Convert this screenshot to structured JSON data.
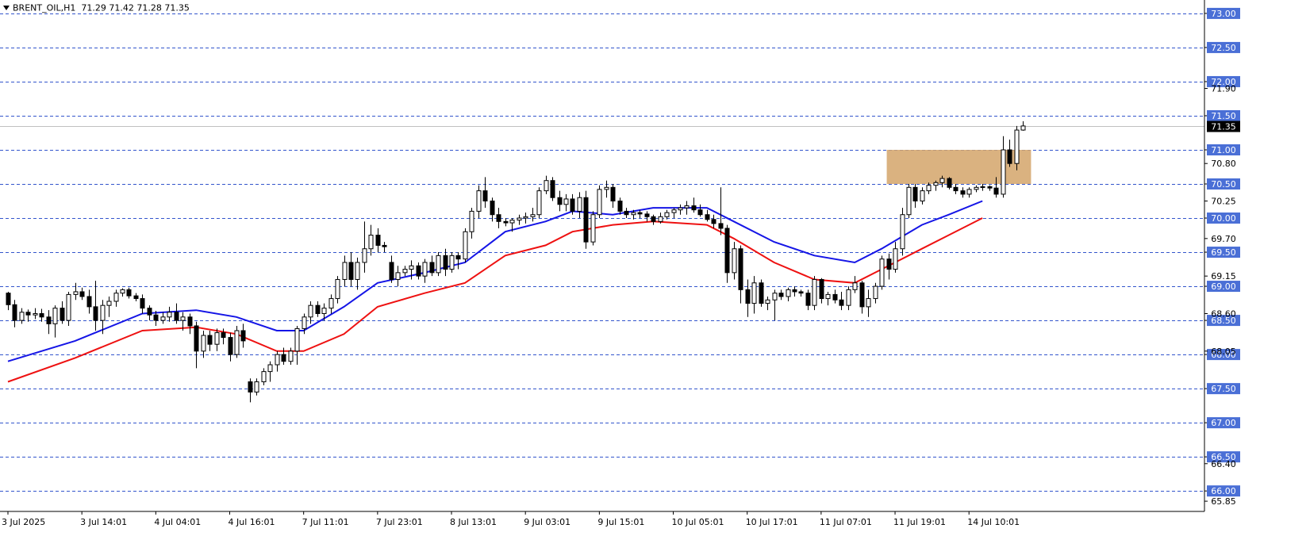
{
  "header": {
    "symbol": "BRENT_OIL,H1",
    "ohlc": "71.29 71.42 71.28 71.35"
  },
  "chart_data": {
    "type": "candlestick",
    "ylim": [
      65.7,
      73.15
    ],
    "current_price": 71.35,
    "current_price_label": "71.35",
    "colors": {
      "level_line": "#3355cc",
      "ma_fast": "#1515e6",
      "ma_slow": "#ee1111",
      "zone": "#d4a56a",
      "bull_body": "#ffffff",
      "bear_body": "#000000",
      "label_bg": "#4a6fd6",
      "current_bg": "#000000"
    },
    "level_lines": [
      "73.00",
      "72.50",
      "72.00",
      "71.50",
      "71.00",
      "70.50",
      "70.00",
      "69.50",
      "69.00",
      "68.50",
      "68.00",
      "67.50",
      "67.00",
      "66.50",
      "66.00"
    ],
    "plain_ticks": [
      "71.90",
      "70.80",
      "70.25",
      "69.70",
      "69.15",
      "68.60",
      "68.05",
      "66.40",
      "65.85"
    ],
    "zone": {
      "price_low": 70.5,
      "price_high": 71.0,
      "from_index": 131,
      "to_index": 152
    },
    "x_labels": [
      {
        "index": 0,
        "label": "3 Jul 2025"
      },
      {
        "index": 11,
        "label": "3 Jul 14:01"
      },
      {
        "index": 22,
        "label": "4 Jul 04:01"
      },
      {
        "index": 33,
        "label": "4 Jul 16:01"
      },
      {
        "index": 44,
        "label": "7 Jul 11:01"
      },
      {
        "index": 55,
        "label": "7 Jul 23:01"
      },
      {
        "index": 66,
        "label": "8 Jul 13:01"
      },
      {
        "index": 77,
        "label": "9 Jul 03:01"
      },
      {
        "index": 88,
        "label": "9 Jul 15:01"
      },
      {
        "index": 99,
        "label": "10 Jul 05:01"
      },
      {
        "index": 110,
        "label": "10 Jul 17:01"
      },
      {
        "index": 121,
        "label": "11 Jul 07:01"
      },
      {
        "index": 132,
        "label": "11 Jul 19:01"
      },
      {
        "index": 143,
        "label": "14 Jul 10:01"
      }
    ],
    "ma_fast": [
      [
        0,
        67.9
      ],
      [
        10,
        68.2
      ],
      [
        20,
        68.6
      ],
      [
        28,
        68.65
      ],
      [
        34,
        68.55
      ],
      [
        40,
        68.35
      ],
      [
        44,
        68.35
      ],
      [
        50,
        68.7
      ],
      [
        55,
        69.05
      ],
      [
        62,
        69.2
      ],
      [
        68,
        69.35
      ],
      [
        74,
        69.8
      ],
      [
        80,
        69.95
      ],
      [
        84,
        70.1
      ],
      [
        90,
        70.05
      ],
      [
        96,
        70.15
      ],
      [
        104,
        70.15
      ],
      [
        108,
        69.95
      ],
      [
        114,
        69.65
      ],
      [
        120,
        69.45
      ],
      [
        126,
        69.35
      ],
      [
        130,
        69.55
      ],
      [
        136,
        69.9
      ],
      [
        140,
        70.05
      ],
      [
        145,
        70.25
      ]
    ],
    "ma_slow": [
      [
        0,
        67.6
      ],
      [
        10,
        67.95
      ],
      [
        20,
        68.35
      ],
      [
        28,
        68.4
      ],
      [
        34,
        68.3
      ],
      [
        40,
        68.05
      ],
      [
        44,
        68.05
      ],
      [
        50,
        68.3
      ],
      [
        55,
        68.7
      ],
      [
        62,
        68.9
      ],
      [
        68,
        69.05
      ],
      [
        74,
        69.45
      ],
      [
        80,
        69.6
      ],
      [
        84,
        69.8
      ],
      [
        90,
        69.9
      ],
      [
        96,
        69.95
      ],
      [
        104,
        69.9
      ],
      [
        108,
        69.7
      ],
      [
        114,
        69.35
      ],
      [
        120,
        69.1
      ],
      [
        126,
        69.05
      ],
      [
        130,
        69.25
      ],
      [
        136,
        69.55
      ],
      [
        140,
        69.75
      ],
      [
        145,
        70.0
      ]
    ],
    "candles": [
      [
        68.9,
        68.92,
        68.65,
        68.73
      ],
      [
        68.73,
        68.8,
        68.4,
        68.5
      ],
      [
        68.5,
        68.68,
        68.45,
        68.62
      ],
      [
        68.62,
        68.66,
        68.48,
        68.58
      ],
      [
        68.58,
        68.68,
        68.52,
        68.6
      ],
      [
        68.6,
        68.67,
        68.48,
        68.55
      ],
      [
        68.55,
        68.65,
        68.3,
        68.45
      ],
      [
        68.45,
        68.72,
        68.25,
        68.68
      ],
      [
        68.68,
        68.78,
        68.45,
        68.5
      ],
      [
        68.5,
        68.92,
        68.42,
        68.88
      ],
      [
        68.88,
        69.05,
        68.8,
        68.92
      ],
      [
        68.92,
        68.98,
        68.8,
        68.85
      ],
      [
        68.85,
        68.95,
        68.6,
        68.7
      ],
      [
        68.7,
        69.08,
        68.35,
        68.5
      ],
      [
        68.5,
        68.8,
        68.3,
        68.72
      ],
      [
        68.72,
        68.85,
        68.55,
        68.78
      ],
      [
        68.78,
        68.95,
        68.7,
        68.9
      ],
      [
        68.9,
        68.97,
        68.85,
        68.95
      ],
      [
        68.95,
        68.98,
        68.82,
        68.86
      ],
      [
        68.86,
        68.9,
        68.78,
        68.82
      ],
      [
        68.82,
        68.88,
        68.6,
        68.68
      ],
      [
        68.68,
        68.72,
        68.5,
        68.58
      ],
      [
        68.58,
        68.64,
        68.42,
        68.5
      ],
      [
        68.5,
        68.62,
        68.45,
        68.55
      ],
      [
        68.55,
        68.7,
        68.48,
        68.62
      ],
      [
        68.62,
        68.75,
        68.45,
        68.5
      ],
      [
        68.5,
        68.62,
        68.35,
        68.55
      ],
      [
        68.55,
        68.6,
        68.3,
        68.42
      ],
      [
        68.42,
        68.48,
        67.8,
        68.05
      ],
      [
        68.05,
        68.35,
        67.95,
        68.28
      ],
      [
        68.28,
        68.35,
        68.05,
        68.15
      ],
      [
        68.15,
        68.38,
        68.05,
        68.32
      ],
      [
        68.32,
        68.38,
        68.15,
        68.25
      ],
      [
        68.25,
        68.32,
        67.9,
        68.0
      ],
      [
        68.0,
        68.42,
        67.95,
        68.35
      ],
      [
        68.35,
        68.45,
        68.1,
        68.2
      ],
      [
        67.6,
        67.65,
        67.3,
        67.45
      ],
      [
        67.45,
        67.65,
        67.4,
        67.6
      ],
      [
        67.6,
        67.8,
        67.55,
        67.75
      ],
      [
        67.75,
        67.9,
        67.6,
        67.85
      ],
      [
        67.85,
        68.05,
        67.75,
        68.0
      ],
      [
        68.0,
        68.1,
        67.85,
        67.9
      ],
      [
        67.9,
        68.1,
        67.85,
        68.05
      ],
      [
        68.05,
        68.42,
        67.85,
        68.38
      ],
      [
        68.38,
        68.6,
        68.3,
        68.55
      ],
      [
        68.55,
        68.78,
        68.45,
        68.72
      ],
      [
        68.72,
        68.78,
        68.55,
        68.6
      ],
      [
        68.6,
        68.75,
        68.5,
        68.68
      ],
      [
        68.68,
        68.88,
        68.6,
        68.82
      ],
      [
        68.82,
        69.15,
        68.75,
        69.1
      ],
      [
        69.1,
        69.45,
        69.0,
        69.35
      ],
      [
        69.35,
        69.5,
        69.0,
        69.1
      ],
      [
        69.1,
        69.42,
        68.95,
        69.35
      ],
      [
        69.35,
        69.95,
        69.2,
        69.55
      ],
      [
        69.55,
        69.9,
        69.45,
        69.75
      ],
      [
        69.75,
        69.85,
        69.5,
        69.6
      ],
      [
        69.6,
        69.65,
        69.5,
        69.58
      ],
      [
        69.35,
        69.45,
        69.05,
        69.1
      ],
      [
        69.1,
        69.3,
        69.0,
        69.2
      ],
      [
        69.2,
        69.3,
        69.15,
        69.25
      ],
      [
        69.25,
        69.38,
        69.1,
        69.3
      ],
      [
        69.3,
        69.35,
        69.1,
        69.15
      ],
      [
        69.15,
        69.4,
        69.05,
        69.35
      ],
      [
        69.35,
        69.45,
        69.15,
        69.2
      ],
      [
        69.2,
        69.5,
        69.15,
        69.45
      ],
      [
        69.45,
        69.55,
        69.15,
        69.25
      ],
      [
        69.25,
        69.5,
        69.2,
        69.45
      ],
      [
        69.45,
        69.5,
        69.25,
        69.4
      ],
      [
        69.4,
        69.85,
        69.35,
        69.8
      ],
      [
        69.8,
        70.15,
        69.7,
        70.1
      ],
      [
        70.1,
        70.48,
        70.0,
        70.4
      ],
      [
        70.4,
        70.6,
        70.15,
        70.25
      ],
      [
        70.25,
        70.3,
        69.95,
        70.05
      ],
      [
        70.05,
        70.15,
        69.85,
        69.95
      ],
      [
        69.95,
        70.0,
        69.88,
        69.93
      ],
      [
        69.93,
        70.0,
        69.8,
        69.97
      ],
      [
        69.97,
        70.05,
        69.9,
        70.0
      ],
      [
        70.0,
        70.08,
        69.92,
        70.02
      ],
      [
        70.02,
        70.15,
        69.95,
        70.05
      ],
      [
        70.05,
        70.45,
        70.0,
        70.4
      ],
      [
        70.4,
        70.62,
        70.35,
        70.55
      ],
      [
        70.55,
        70.6,
        70.25,
        70.3
      ],
      [
        70.3,
        70.4,
        70.1,
        70.2
      ],
      [
        70.2,
        70.35,
        70.1,
        70.28
      ],
      [
        70.28,
        70.35,
        70.05,
        70.1
      ],
      [
        70.1,
        70.38,
        70.0,
        70.3
      ],
      [
        70.3,
        70.4,
        69.55,
        69.65
      ],
      [
        69.65,
        70.1,
        69.6,
        70.05
      ],
      [
        70.05,
        70.48,
        70.0,
        70.42
      ],
      [
        70.42,
        70.55,
        70.3,
        70.45
      ],
      [
        70.45,
        70.5,
        70.15,
        70.25
      ],
      [
        70.25,
        70.3,
        70.05,
        70.1
      ],
      [
        70.1,
        70.15,
        70.0,
        70.05
      ],
      [
        70.05,
        70.12,
        69.98,
        70.08
      ],
      [
        70.08,
        70.12,
        70.0,
        70.06
      ],
      [
        70.06,
        70.1,
        69.95,
        70.02
      ],
      [
        70.02,
        70.05,
        69.9,
        69.95
      ],
      [
        69.95,
        70.08,
        69.92,
        70.02
      ],
      [
        70.02,
        70.12,
        69.98,
        70.08
      ],
      [
        70.08,
        70.15,
        70.0,
        70.12
      ],
      [
        70.12,
        70.2,
        70.05,
        70.15
      ],
      [
        70.15,
        70.25,
        70.05,
        70.18
      ],
      [
        70.18,
        70.3,
        70.08,
        70.12
      ],
      [
        70.12,
        70.2,
        70.02,
        70.05
      ],
      [
        70.05,
        70.12,
        69.95,
        69.98
      ],
      [
        69.98,
        70.05,
        69.85,
        69.92
      ],
      [
        69.92,
        70.45,
        69.75,
        69.85
      ],
      [
        69.85,
        69.9,
        69.05,
        69.2
      ],
      [
        69.2,
        69.65,
        69.1,
        69.55
      ],
      [
        69.55,
        69.6,
        68.75,
        68.95
      ],
      [
        68.95,
        69.1,
        68.55,
        68.75
      ],
      [
        68.75,
        69.15,
        68.6,
        69.05
      ],
      [
        69.05,
        69.1,
        68.7,
        68.75
      ],
      [
        68.75,
        68.85,
        68.65,
        68.8
      ],
      [
        68.8,
        68.95,
        68.5,
        68.9
      ],
      [
        68.9,
        68.95,
        68.8,
        68.85
      ],
      [
        68.85,
        68.98,
        68.78,
        68.95
      ],
      [
        68.95,
        69.0,
        68.85,
        68.92
      ],
      [
        68.92,
        68.95,
        68.85,
        68.9
      ],
      [
        68.9,
        68.95,
        68.65,
        68.72
      ],
      [
        68.72,
        69.15,
        68.65,
        69.1
      ],
      [
        69.1,
        69.12,
        68.75,
        68.82
      ],
      [
        68.82,
        68.92,
        68.72,
        68.88
      ],
      [
        68.88,
        68.95,
        68.75,
        68.8
      ],
      [
        68.8,
        68.92,
        68.65,
        68.72
      ],
      [
        68.72,
        69.0,
        68.65,
        68.95
      ],
      [
        68.95,
        69.15,
        68.9,
        69.05
      ],
      [
        69.05,
        69.08,
        68.6,
        68.7
      ],
      [
        68.7,
        68.95,
        68.55,
        68.82
      ],
      [
        68.82,
        69.05,
        68.75,
        69.0
      ],
      [
        69.0,
        69.45,
        68.95,
        69.4
      ],
      [
        69.4,
        69.48,
        69.1,
        69.25
      ],
      [
        69.25,
        69.65,
        69.2,
        69.55
      ],
      [
        69.55,
        70.15,
        69.45,
        70.05
      ],
      [
        70.05,
        70.5,
        70.0,
        70.45
      ],
      [
        70.45,
        70.5,
        70.15,
        70.25
      ],
      [
        70.25,
        70.45,
        70.2,
        70.4
      ],
      [
        70.4,
        70.52,
        70.35,
        70.48
      ],
      [
        70.48,
        70.55,
        70.4,
        70.52
      ],
      [
        70.52,
        70.62,
        70.45,
        70.58
      ],
      [
        70.58,
        70.6,
        70.42,
        70.45
      ],
      [
        70.45,
        70.5,
        70.35,
        70.4
      ],
      [
        70.4,
        70.45,
        70.3,
        70.35
      ],
      [
        70.35,
        70.45,
        70.3,
        70.42
      ],
      [
        70.42,
        70.48,
        70.38,
        70.45
      ],
      [
        70.45,
        70.5,
        70.4,
        70.46
      ],
      [
        70.46,
        70.48,
        70.4,
        70.44
      ],
      [
        70.44,
        70.6,
        70.3,
        70.35
      ],
      [
        70.35,
        71.2,
        70.3,
        71.0
      ],
      [
        71.0,
        71.15,
        70.75,
        70.8
      ],
      [
        70.8,
        71.35,
        70.7,
        71.29
      ],
      [
        71.29,
        71.42,
        71.28,
        71.35
      ]
    ]
  }
}
